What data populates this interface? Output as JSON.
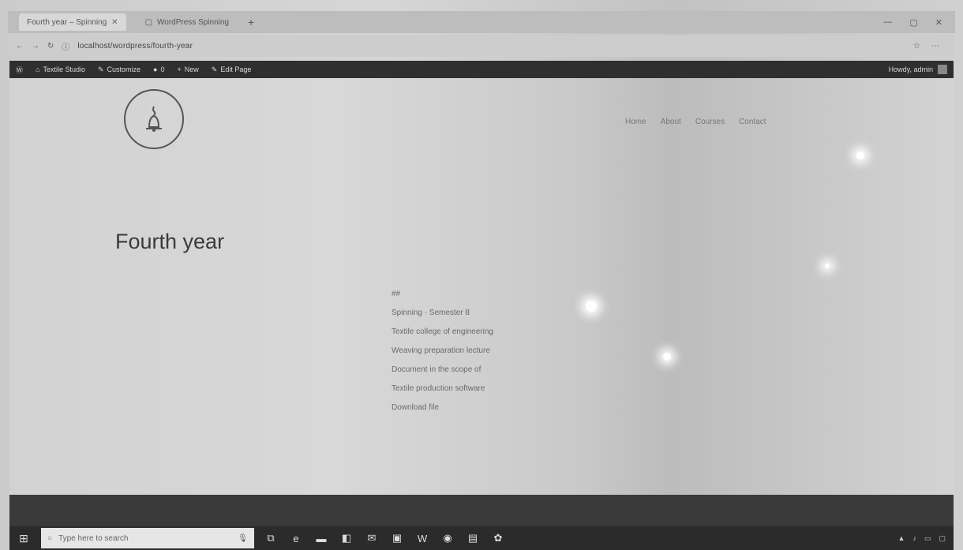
{
  "browser": {
    "tabs": [
      {
        "label": "Fourth year – Spinning"
      },
      {
        "label": "WordPress Spinning"
      }
    ],
    "url": "localhost/wordpress/fourth-year"
  },
  "adminbar": {
    "items": [
      {
        "icon": "wordpress-icon",
        "label": ""
      },
      {
        "icon": "home-icon",
        "label": "Textile Studio"
      },
      {
        "icon": "customize-icon",
        "label": "Customize"
      },
      {
        "icon": "comment-icon",
        "label": "0"
      },
      {
        "icon": "plus-icon",
        "label": "New"
      },
      {
        "icon": "edit-icon",
        "label": "Edit Page"
      }
    ],
    "greeting": "Howdy, admin"
  },
  "nav": [
    "Home",
    "About",
    "Courses",
    "Contact"
  ],
  "page": {
    "title": "Fourth year",
    "lines": [
      "##",
      "Spinning · Semester 8",
      "Textile college of engineering",
      "Weaving preparation lecture",
      "Document in the scope of",
      "Textile production software",
      "Download file"
    ]
  },
  "taskbar": {
    "search_placeholder": "Type here to search",
    "icons": [
      "task-view-icon",
      "edge-icon",
      "file-explorer-icon",
      "store-icon",
      "mail-icon",
      "photos-icon",
      "word-icon",
      "chrome-icon",
      "app-icon",
      "paint-icon"
    ]
  }
}
